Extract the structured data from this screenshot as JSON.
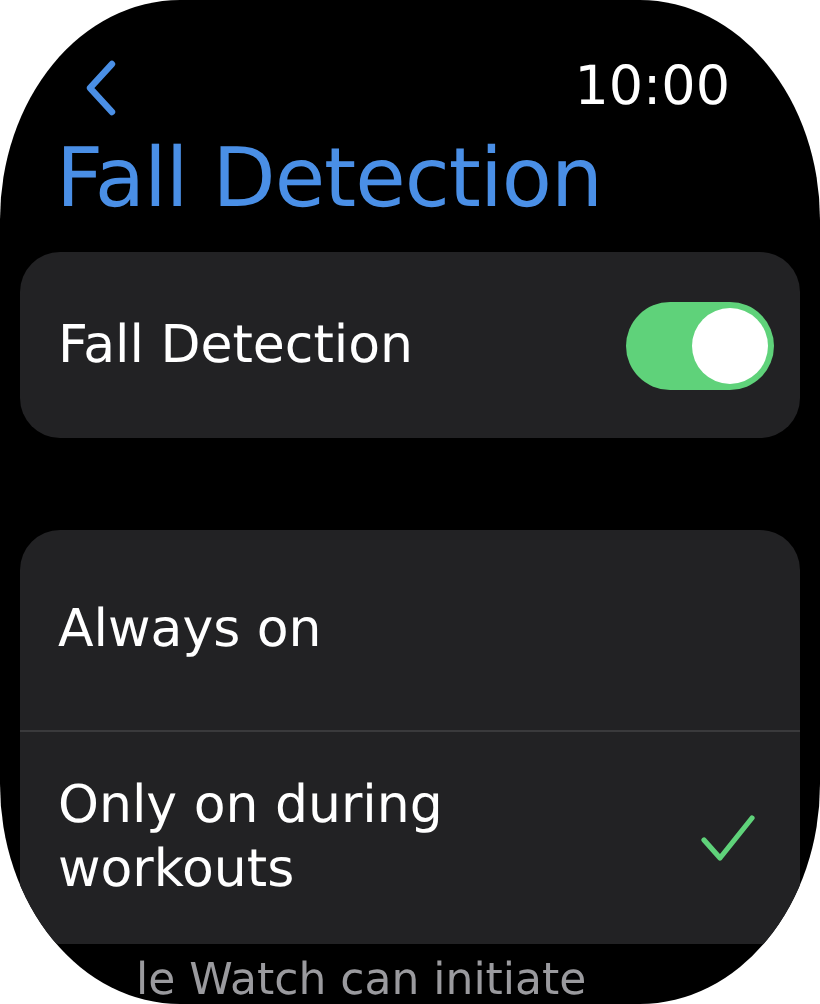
{
  "status_bar": {
    "time": "10:00"
  },
  "title": "Fall Detection",
  "toggle": {
    "label": "Fall Detection",
    "on": true
  },
  "options": [
    {
      "label": "Always on",
      "selected": false
    },
    {
      "label": "Only on during workouts",
      "selected": true
    }
  ],
  "footer": "le Watch can initiate"
}
